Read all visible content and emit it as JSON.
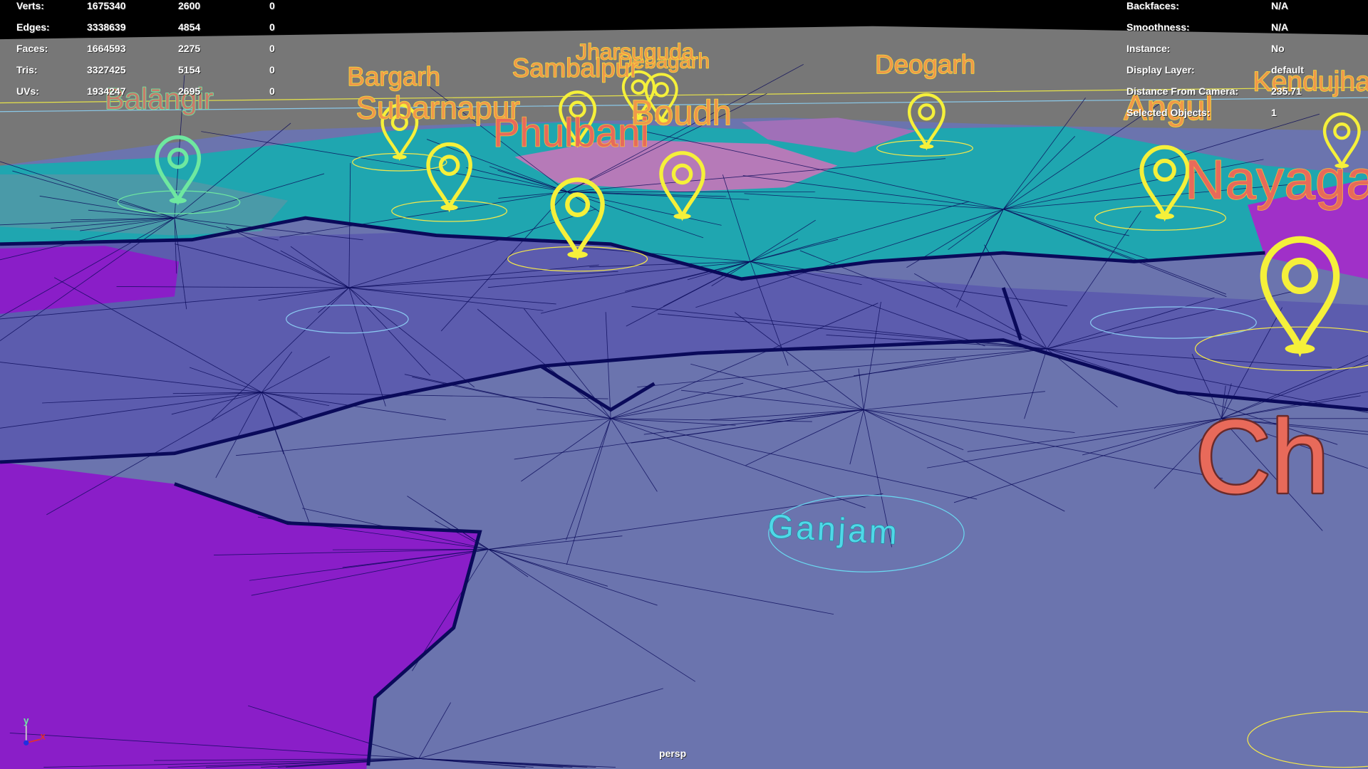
{
  "hud_left": {
    "rows": [
      {
        "label": "Verts:",
        "total": "1675340",
        "selected": "2600",
        "extra": "0"
      },
      {
        "label": "Edges:",
        "total": "3338639",
        "selected": "4854",
        "extra": "0"
      },
      {
        "label": "Faces:",
        "total": "1664593",
        "selected": "2275",
        "extra": "0"
      },
      {
        "label": "Tris:",
        "total": "3327425",
        "selected": "5154",
        "extra": "0"
      },
      {
        "label": "UVs:",
        "total": "1934247",
        "selected": "2695",
        "extra": "0"
      }
    ]
  },
  "hud_right": {
    "rows": [
      {
        "label": "Backfaces:",
        "value": "N/A"
      },
      {
        "label": "Smoothness:",
        "value": "N/A"
      },
      {
        "label": "Instance:",
        "value": "No"
      },
      {
        "label": "Display Layer:",
        "value": "default"
      },
      {
        "label": "Distance From Camera:",
        "value": "235.71"
      },
      {
        "label": "Selected Objects:",
        "value": "1"
      }
    ]
  },
  "camera_name": "persp",
  "axis": {
    "y": "y",
    "x": "x"
  },
  "district_labels": {
    "balangir": "Balāngir",
    "bargarh": "Bargarh",
    "sambalpur": "Sambalpur",
    "jharsuguda": "Jharsuguda",
    "debagarh": "Debagarh",
    "deogarh": "Deogarh",
    "subarnapur": "Subarnapur",
    "phulbani": "Phulbani",
    "boudh": "Boudh",
    "angul": "Angul",
    "kendujhar": "Kendujhar",
    "nayagarh": "Nayagarh",
    "chilika": "Ch",
    "ganjam": "Ganjam"
  },
  "colors": {
    "background_top": "#000000",
    "horizon": "#777777",
    "teal_region": "#1fa6b0",
    "purple_region": "#5c5cae",
    "lavender_region": "#6b74ae",
    "magenta_region": "#8a1ec8",
    "pink_region": "#b67ab8",
    "wire": "#0a0a5a",
    "pin": "#f5f03a"
  }
}
